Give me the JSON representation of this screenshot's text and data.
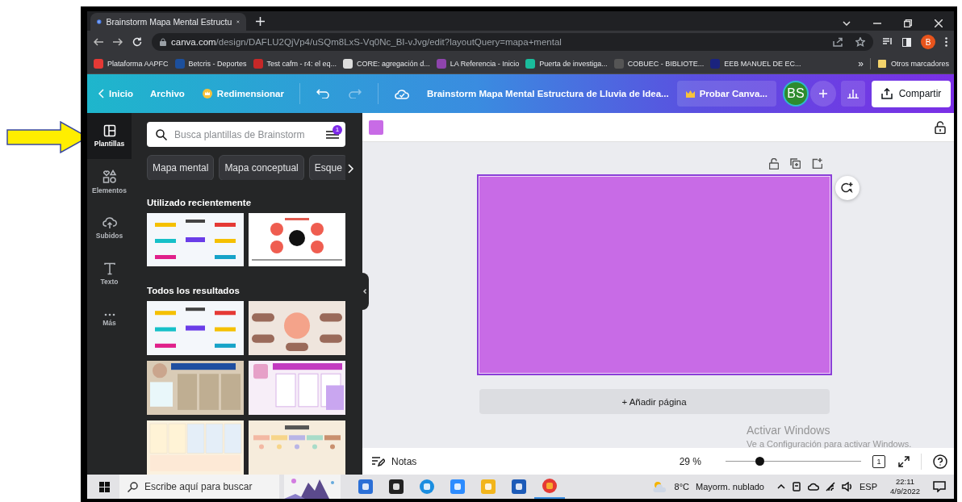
{
  "browser": {
    "tab_title": "Brainstorm Mapa Mental Estructu",
    "url_host": "canva.com",
    "url_path": "/design/DAFLU2QjVp4/uSQm8LxS-Vq0Nc_BI-vJvg/edit?layoutQuery=mapa+mental",
    "profile": "B",
    "bookmarks": [
      {
        "label": "Plataforma AAPFC",
        "color": "#e53935"
      },
      {
        "label": "Betcris - Deportes",
        "color": "#1c4f9c"
      },
      {
        "label": "Test cafm - r4: el eq...",
        "color": "#c62828"
      },
      {
        "label": "CORE: agregación d...",
        "color": "#dddddd"
      },
      {
        "label": "LA Referencia - Inicio",
        "color": "#8e44ad"
      },
      {
        "label": "Puerta de investiga...",
        "color": "#1abc9c"
      },
      {
        "label": "COBUEC - BIBLIOTE...",
        "color": "#555555"
      },
      {
        "label": "EEB MANUEL DE EC...",
        "color": "#1a237e"
      }
    ],
    "more": "»",
    "other_bookmarks": "Otros marcadores"
  },
  "header": {
    "back": "Inicio",
    "file": "Archivo",
    "resize": "Redimensionar",
    "title": "Brainstorm Mapa Mental Estructura de Lluvia de Idea...",
    "pro": "Probar Canva...",
    "avatar": "BS",
    "share": "Compartir"
  },
  "sidebar": [
    {
      "kind": "templates",
      "label": "Plantillas",
      "selected": true
    },
    {
      "kind": "elements",
      "label": "Elementos",
      "selected": false
    },
    {
      "kind": "uploads",
      "label": "Subidos",
      "selected": false
    },
    {
      "kind": "text",
      "label": "Texto",
      "selected": false
    },
    {
      "kind": "more",
      "label": "Más",
      "selected": false
    }
  ],
  "panel": {
    "search_placeholder": "Busca plantillas de Brainstorm",
    "filter_badge": "1",
    "chips": [
      "Mapa mental",
      "Mapa conceptual",
      "Esque"
    ],
    "recent_heading": "Utilizado recientemente",
    "recent": [
      {
        "kind": "picture"
      },
      {
        "kind": "picture"
      }
    ],
    "all_heading": "Todos los resultados",
    "results": [
      {
        "kind": "picture"
      },
      {
        "kind": "picture"
      },
      {
        "kind": "picture"
      },
      {
        "kind": "picture"
      },
      {
        "kind": "picture"
      },
      {
        "kind": "picture"
      }
    ]
  },
  "editor": {
    "add_page": "+ Añadir página",
    "notes": "Notas",
    "zoom": "29 %",
    "zoom_slider": {
      "level": 0.25
    },
    "page_count": "1"
  },
  "windows_notice": {
    "title": "Activar Windows",
    "text": "Ve a Configuración para activar Windows."
  },
  "taskbar": {
    "search_placeholder": "Escribe aquí para buscar",
    "temperature": "8°C",
    "weather": "Mayorm. nublado",
    "language": "ESP",
    "time": "22:11",
    "date": "4/9/2022"
  }
}
